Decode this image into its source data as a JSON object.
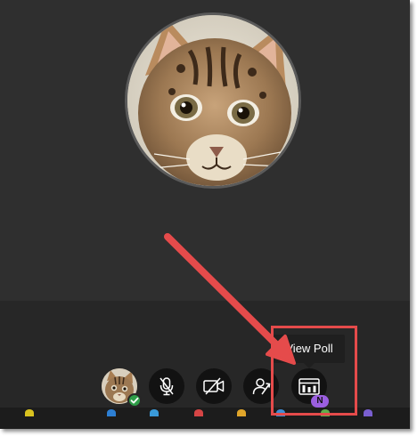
{
  "meeting": {
    "participant_video": {
      "avatar_icon": "cat-avatar"
    },
    "controls": [
      {
        "name": "self-avatar",
        "icon": "cat-avatar",
        "status_icon": "check-icon",
        "status_color": "#2e9e48"
      },
      {
        "name": "microphone-toggle",
        "icon": "microphone-muted-icon"
      },
      {
        "name": "camera-toggle",
        "icon": "camera-off-icon"
      },
      {
        "name": "share-content",
        "icon": "share-content-icon"
      },
      {
        "name": "poll",
        "icon": "poll-icon",
        "badge": "N",
        "badge_color": "#9b5fe0"
      }
    ],
    "tooltip": {
      "text": "View Poll"
    }
  },
  "annotation": {
    "arrow_color": "#e54b4b",
    "highlight_color": "#e54b4b"
  },
  "colors": {
    "stage_background": "#2f2f2f",
    "control_bar": "#272727",
    "control_button": "#121212",
    "taskbar": "#1c1c1c"
  }
}
